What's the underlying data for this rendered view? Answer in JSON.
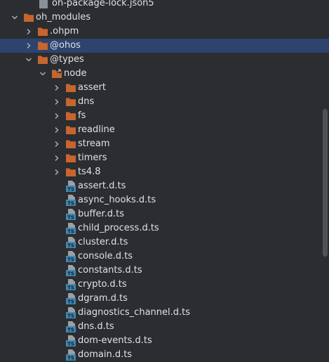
{
  "tree": {
    "partial_top_label": "oh-package-lock.json5",
    "rows": [
      {
        "label": "oh_modules",
        "kind": "folder",
        "expanded": true,
        "depth": 0,
        "selected": false
      },
      {
        "label": ".ohpm",
        "kind": "folder",
        "expanded": false,
        "depth": 1,
        "selected": false
      },
      {
        "label": "@ohos",
        "kind": "folder",
        "expanded": false,
        "depth": 1,
        "selected": true
      },
      {
        "label": "@types",
        "kind": "folder",
        "expanded": true,
        "depth": 1,
        "selected": false
      },
      {
        "label": "node",
        "kind": "folder-linked",
        "expanded": true,
        "depth": 2,
        "selected": false
      },
      {
        "label": "assert",
        "kind": "folder",
        "expanded": false,
        "depth": 3,
        "selected": false
      },
      {
        "label": "dns",
        "kind": "folder",
        "expanded": false,
        "depth": 3,
        "selected": false
      },
      {
        "label": "fs",
        "kind": "folder",
        "expanded": false,
        "depth": 3,
        "selected": false
      },
      {
        "label": "readline",
        "kind": "folder",
        "expanded": false,
        "depth": 3,
        "selected": false
      },
      {
        "label": "stream",
        "kind": "folder",
        "expanded": false,
        "depth": 3,
        "selected": false
      },
      {
        "label": "timers",
        "kind": "folder",
        "expanded": false,
        "depth": 3,
        "selected": false
      },
      {
        "label": "ts4.8",
        "kind": "folder",
        "expanded": false,
        "depth": 3,
        "selected": false
      },
      {
        "label": "assert.d.ts",
        "kind": "ts-file",
        "depth": 3
      },
      {
        "label": "async_hooks.d.ts",
        "kind": "ts-file",
        "depth": 3
      },
      {
        "label": "buffer.d.ts",
        "kind": "ts-file",
        "depth": 3
      },
      {
        "label": "child_process.d.ts",
        "kind": "ts-file",
        "depth": 3
      },
      {
        "label": "cluster.d.ts",
        "kind": "ts-file",
        "depth": 3
      },
      {
        "label": "console.d.ts",
        "kind": "ts-file",
        "depth": 3
      },
      {
        "label": "constants.d.ts",
        "kind": "ts-file",
        "depth": 3
      },
      {
        "label": "crypto.d.ts",
        "kind": "ts-file",
        "depth": 3
      },
      {
        "label": "dgram.d.ts",
        "kind": "ts-file",
        "depth": 3
      },
      {
        "label": "diagnostics_channel.d.ts",
        "kind": "ts-file",
        "depth": 3
      },
      {
        "label": "dns.d.ts",
        "kind": "ts-file",
        "depth": 3
      },
      {
        "label": "dom-events.d.ts",
        "kind": "ts-file",
        "depth": 3
      },
      {
        "label": "domain.d.ts",
        "kind": "ts-file",
        "depth": 3
      }
    ]
  },
  "colors": {
    "background": "#2b2d30",
    "selection": "#2e436e",
    "folder": "#c7652f",
    "ts_icon": "#3f87b5",
    "text": "#dfe1e5",
    "chevron": "#a8adb3",
    "scrollbar": "#4e5157"
  },
  "icons": {
    "folder": "folder-icon",
    "folder-linked": "linked-folder-icon",
    "ts-file": "typescript-file-icon",
    "expanded": "chevron-down-icon",
    "collapsed": "chevron-right-icon"
  }
}
